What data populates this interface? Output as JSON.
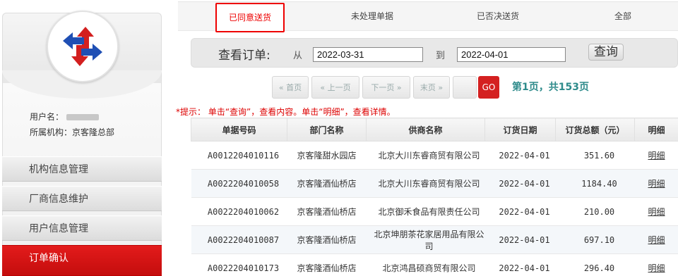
{
  "sidebar": {
    "user_label": "用户名：",
    "org_label": "所属机构：京客隆总部",
    "menu": [
      {
        "label": "机构信息管理"
      },
      {
        "label": "厂商信息维护"
      },
      {
        "label": "用户信息管理"
      },
      {
        "label": "订单确认"
      }
    ]
  },
  "tabs": [
    {
      "label": "已同意送货"
    },
    {
      "label": "未处理单据"
    },
    {
      "label": "已否决送货"
    },
    {
      "label": "全部"
    }
  ],
  "search": {
    "title": "查看订单:",
    "from_label": "从",
    "to_label": "到",
    "from_value": "2022-03-31",
    "to_value": "2022-04-01",
    "button": "查询"
  },
  "pager": {
    "first": "首页",
    "prev": "上一页",
    "next": "下一页",
    "last": "末页",
    "go": "GO",
    "info": "第1页，共153页"
  },
  "hint": "*提示： 单击“查询”，查看内容。单击“明细”，查看详情。",
  "table": {
    "headers": [
      "单据号码",
      "部门名称",
      "供商名称",
      "订货日期",
      "订货总额（元）",
      "明细"
    ],
    "rows": [
      {
        "id": "A0012204010116",
        "dept": "京客隆甜水园店",
        "supplier": "北京大川东睿商贸有限公司",
        "date": "2022-04-01",
        "amount": "351.60",
        "detail": "明细"
      },
      {
        "id": "A0022204010058",
        "dept": "京客隆酒仙桥店",
        "supplier": "北京大川东睿商贸有限公司",
        "date": "2022-04-01",
        "amount": "1184.40",
        "detail": "明细"
      },
      {
        "id": "A0022204010062",
        "dept": "京客隆酒仙桥店",
        "supplier": "北京御禾食品有限责任公司",
        "date": "2022-04-01",
        "amount": "210.00",
        "detail": "明细"
      },
      {
        "id": "A0022204010087",
        "dept": "京客隆酒仙桥店",
        "supplier": "北京坤朋茶花家居用品有限公司",
        "date": "2022-04-01",
        "amount": "697.10",
        "detail": "明细"
      },
      {
        "id": "A0022204010173",
        "dept": "京客隆酒仙桥店",
        "supplier": "北京鸿昌硕商贸有限公司",
        "date": "2022-04-01",
        "amount": "296.40",
        "detail": "明细"
      }
    ]
  },
  "colors": {
    "accent": "#e00000",
    "pager_info": "#2e8b8b",
    "link": "#1a4fc4"
  }
}
